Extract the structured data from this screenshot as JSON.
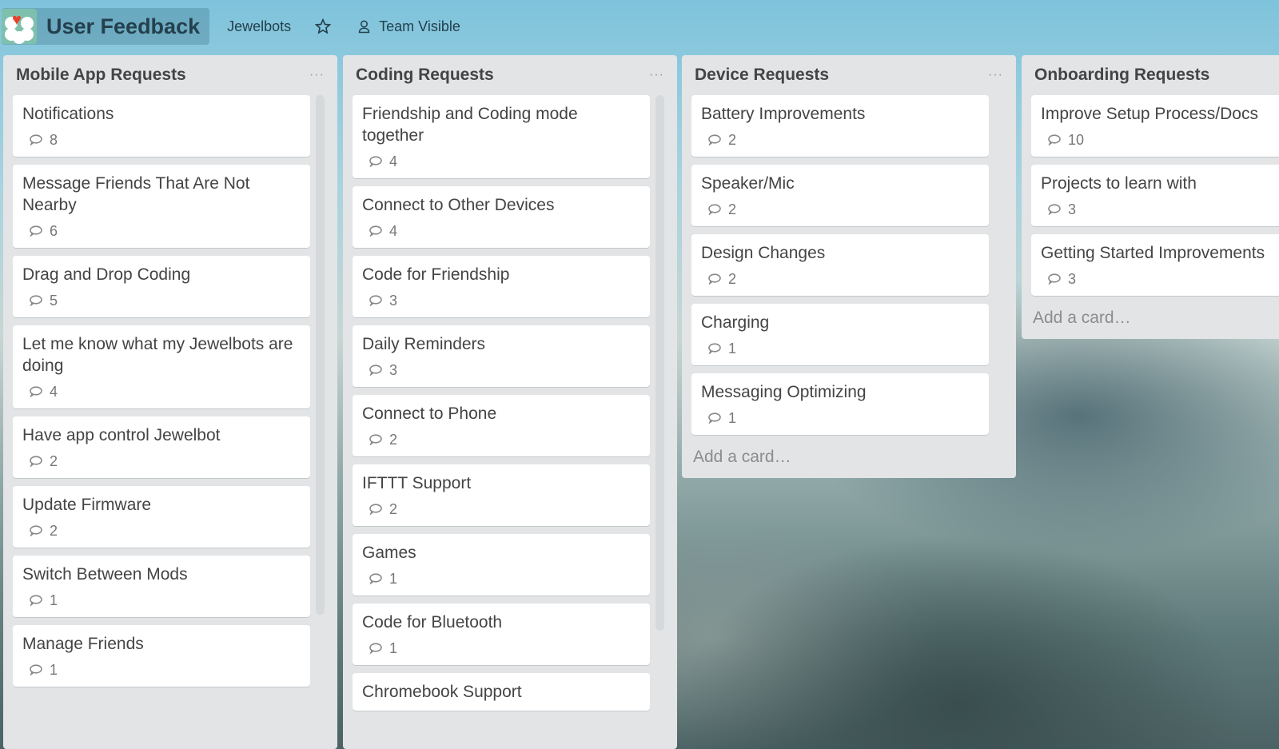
{
  "header": {
    "board_title": "User Feedback",
    "team": "Jewelbots",
    "visibility": "Team Visible"
  },
  "lists": [
    {
      "title": "Mobile App Requests",
      "menu": "···",
      "cards": [
        {
          "title": "Notifications",
          "comments": "8"
        },
        {
          "title": "Message Friends That Are Not Nearby",
          "comments": "6"
        },
        {
          "title": "Drag and Drop Coding",
          "comments": "5"
        },
        {
          "title": "Let me know what my Jewelbots are doing",
          "comments": "4"
        },
        {
          "title": "Have app control Jewelbot",
          "comments": "2"
        },
        {
          "title": "Update Firmware",
          "comments": "2"
        },
        {
          "title": "Switch Between Mods",
          "comments": "1"
        },
        {
          "title": "Manage Friends",
          "comments": "1"
        }
      ]
    },
    {
      "title": "Coding Requests",
      "menu": "···",
      "cards": [
        {
          "title": "Friendship and Coding mode together",
          "comments": "4"
        },
        {
          "title": "Connect to Other Devices",
          "comments": "4"
        },
        {
          "title": "Code for Friendship",
          "comments": "3"
        },
        {
          "title": "Daily Reminders",
          "comments": "3"
        },
        {
          "title": "Connect to Phone",
          "comments": "2"
        },
        {
          "title": "IFTTT Support",
          "comments": "2"
        },
        {
          "title": "Games",
          "comments": "1"
        },
        {
          "title": "Code for Bluetooth",
          "comments": "1"
        },
        {
          "title": "Chromebook Support",
          "comments": ""
        }
      ]
    },
    {
      "title": "Device Requests",
      "menu": "···",
      "add_card": "Add a card…",
      "cards": [
        {
          "title": "Battery Improvements",
          "comments": "2"
        },
        {
          "title": "Speaker/Mic",
          "comments": "2"
        },
        {
          "title": "Design Changes",
          "comments": "2"
        },
        {
          "title": "Charging",
          "comments": "1"
        },
        {
          "title": "Messaging Optimizing",
          "comments": "1"
        }
      ]
    },
    {
      "title": "Onboarding Requests",
      "add_card": "Add a card…",
      "cards": [
        {
          "title": "Improve Setup Process/Docs",
          "comments": "10"
        },
        {
          "title": "Projects to learn with",
          "comments": "3"
        },
        {
          "title": "Getting Started Improvements",
          "comments": "3"
        }
      ]
    }
  ]
}
